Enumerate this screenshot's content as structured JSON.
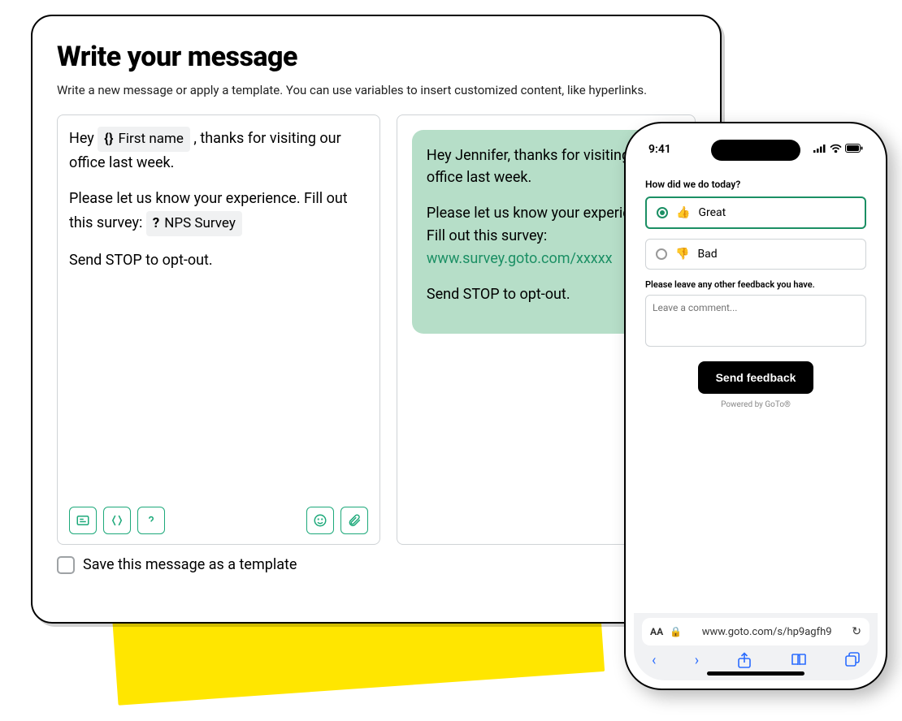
{
  "panel": {
    "title": "Write your message",
    "subtitle": "Write a new message or apply a template. You can use variables to insert customized content, like hyperlinks."
  },
  "editor": {
    "line1_pre": "Hey ",
    "variable_chip": "First name",
    "line1_post": " , thanks for visiting our office last week.",
    "line2_pre": "Please let us know your experience. Fill out this survey: ",
    "survey_chip": "NPS Survey",
    "line3": "Send STOP to opt-out."
  },
  "preview": {
    "p1": "Hey Jennifer, thanks for visiting our office last week.",
    "p2_pre": "Please let us know your experience. Fill out this survey: ",
    "link": "www.survey.goto.com/xxxxx",
    "p3": "Send STOP to opt-out."
  },
  "save": {
    "label": "Save this message as a template"
  },
  "phone": {
    "time": "9:41",
    "question": "How did we do today?",
    "opt_great": "Great",
    "opt_bad": "Bad",
    "feedback_label": "Please leave any other feedback you have.",
    "placeholder": "Leave a comment...",
    "send": "Send feedback",
    "powered": "Powered by GoTo®",
    "url": "www.goto.com/s/hp9agfh9",
    "aa": "AA"
  }
}
